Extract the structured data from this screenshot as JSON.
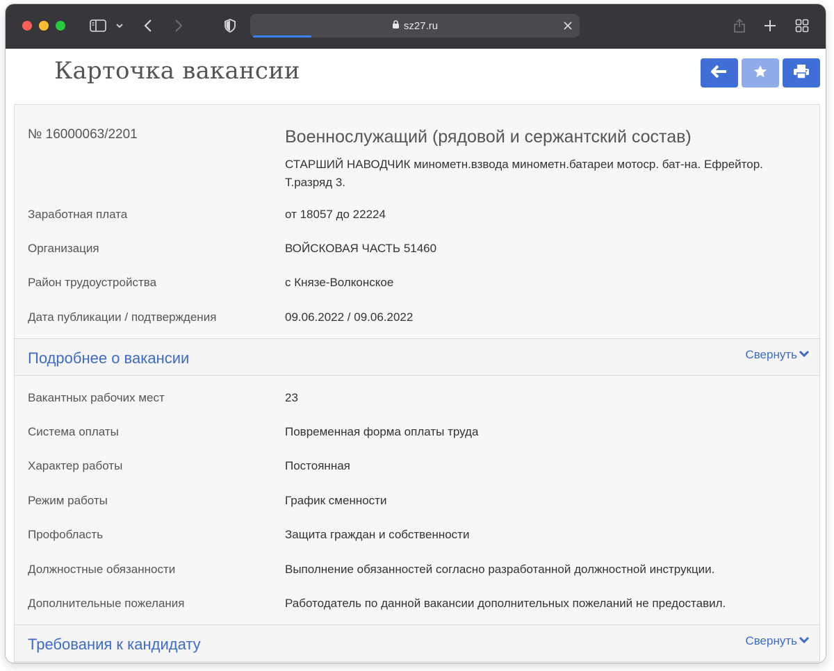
{
  "browser": {
    "url": "sz27.ru"
  },
  "page": {
    "title": "Карточка вакансии"
  },
  "vacancy": {
    "number": "№ 16000063/2201",
    "title": "Военнослужащий (рядовой и сержантский состав)",
    "description": "СТАРШИЙ НАВОДЧИК минометн.взвода минометн.батареи мотоср. бат-на. Ефрейтор. Т.разряд 3.",
    "summary": [
      {
        "label": "Заработная плата",
        "value": "от 18057 до 22224"
      },
      {
        "label": "Организация",
        "value": "ВОЙСКОВАЯ ЧАСТЬ 51460"
      },
      {
        "label": "Район трудоустройства",
        "value": "с Князе-Волконское"
      },
      {
        "label": "Дата публикации / подтверждения",
        "value": "09.06.2022 / 09.06.2022"
      }
    ]
  },
  "details": {
    "title": "Подробнее о вакансии",
    "toggle": "Свернуть",
    "rows": [
      {
        "label": "Вакантных рабочих мест",
        "value": "23"
      },
      {
        "label": "Система оплаты",
        "value": "Повременная форма оплаты труда"
      },
      {
        "label": "Характер работы",
        "value": "Постоянная"
      },
      {
        "label": "Режим работы",
        "value": "График сменности"
      },
      {
        "label": "Профобласть",
        "value": "Защита граждан и собственности"
      },
      {
        "label": "Должностные обязанности",
        "value": "Выполнение обязанностей согласно разработанной должностной инструкции."
      },
      {
        "label": "Дополнительные пожелания",
        "value": "Работодатель по данной вакансии дополнительных пожеланий не предоставил."
      }
    ]
  },
  "requirements": {
    "title": "Требования к кандидату",
    "toggle": "Свернуть"
  },
  "icons": {
    "back": "arrow-left-icon",
    "favorite": "star-icon",
    "print": "print-icon"
  },
  "colors": {
    "accent": "#3f6fd6",
    "accent_disabled": "#8fabe9",
    "link": "#3e6bc9",
    "chrome": "#37373b"
  }
}
